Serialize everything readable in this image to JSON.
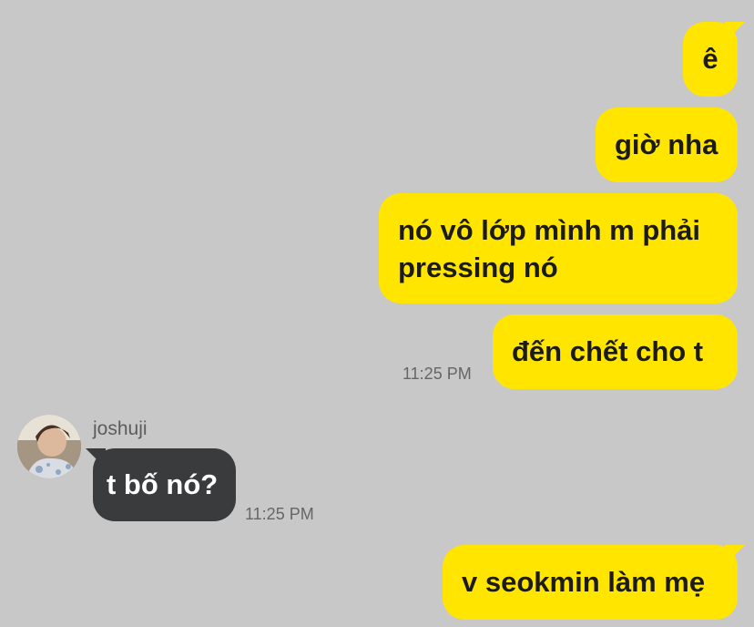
{
  "chat": {
    "outgoing": [
      {
        "text": "ê"
      },
      {
        "text": "giờ nha"
      },
      {
        "line1": "nó vô lớp mình m phải",
        "line2": "pressing nó"
      },
      {
        "text": "đến chết cho t"
      },
      {
        "text": "v seokmin làm mẹ"
      }
    ],
    "outgoing_time": "11:25 PM",
    "incoming": {
      "sender": "joshuji",
      "avatar": "profile-photo",
      "text": "t bố nó?",
      "time": "11:25 PM"
    }
  },
  "colors": {
    "background": "#c8c8c8",
    "outgoing_bubble": "#ffe500",
    "incoming_bubble": "#3a3b3d"
  }
}
